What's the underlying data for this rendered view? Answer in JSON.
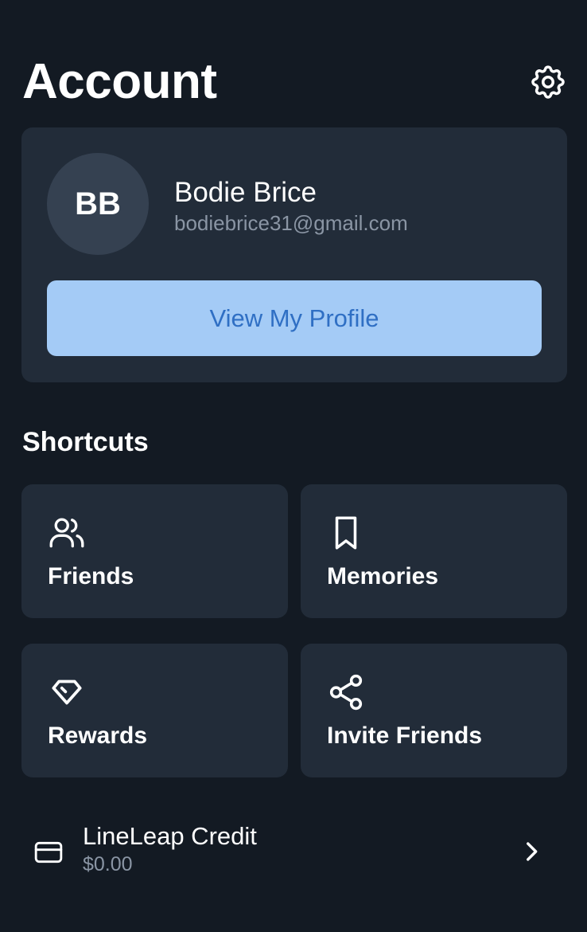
{
  "header": {
    "title": "Account",
    "settings_icon": "gear-icon"
  },
  "profile": {
    "initials": "BB",
    "name": "Bodie Brice",
    "email": "bodiebrice31@gmail.com",
    "view_profile_label": "View My Profile"
  },
  "shortcuts": {
    "title": "Shortcuts",
    "items": [
      {
        "label": "Friends",
        "icon": "friends-icon"
      },
      {
        "label": "Memories",
        "icon": "bookmark-icon"
      },
      {
        "label": "Rewards",
        "icon": "diamond-tag-icon"
      },
      {
        "label": "Invite Friends",
        "icon": "share-icon"
      }
    ]
  },
  "credit": {
    "title": "LineLeap Credit",
    "amount": "$0.00",
    "icon": "credit-card-icon",
    "chevron": "chevron-right-icon"
  },
  "colors": {
    "background": "#131a23",
    "card": "#222c39",
    "avatar": "#354151",
    "button": "#a4cbf6",
    "button_text": "#2f6fc4",
    "muted_text": "#8a95a4"
  }
}
